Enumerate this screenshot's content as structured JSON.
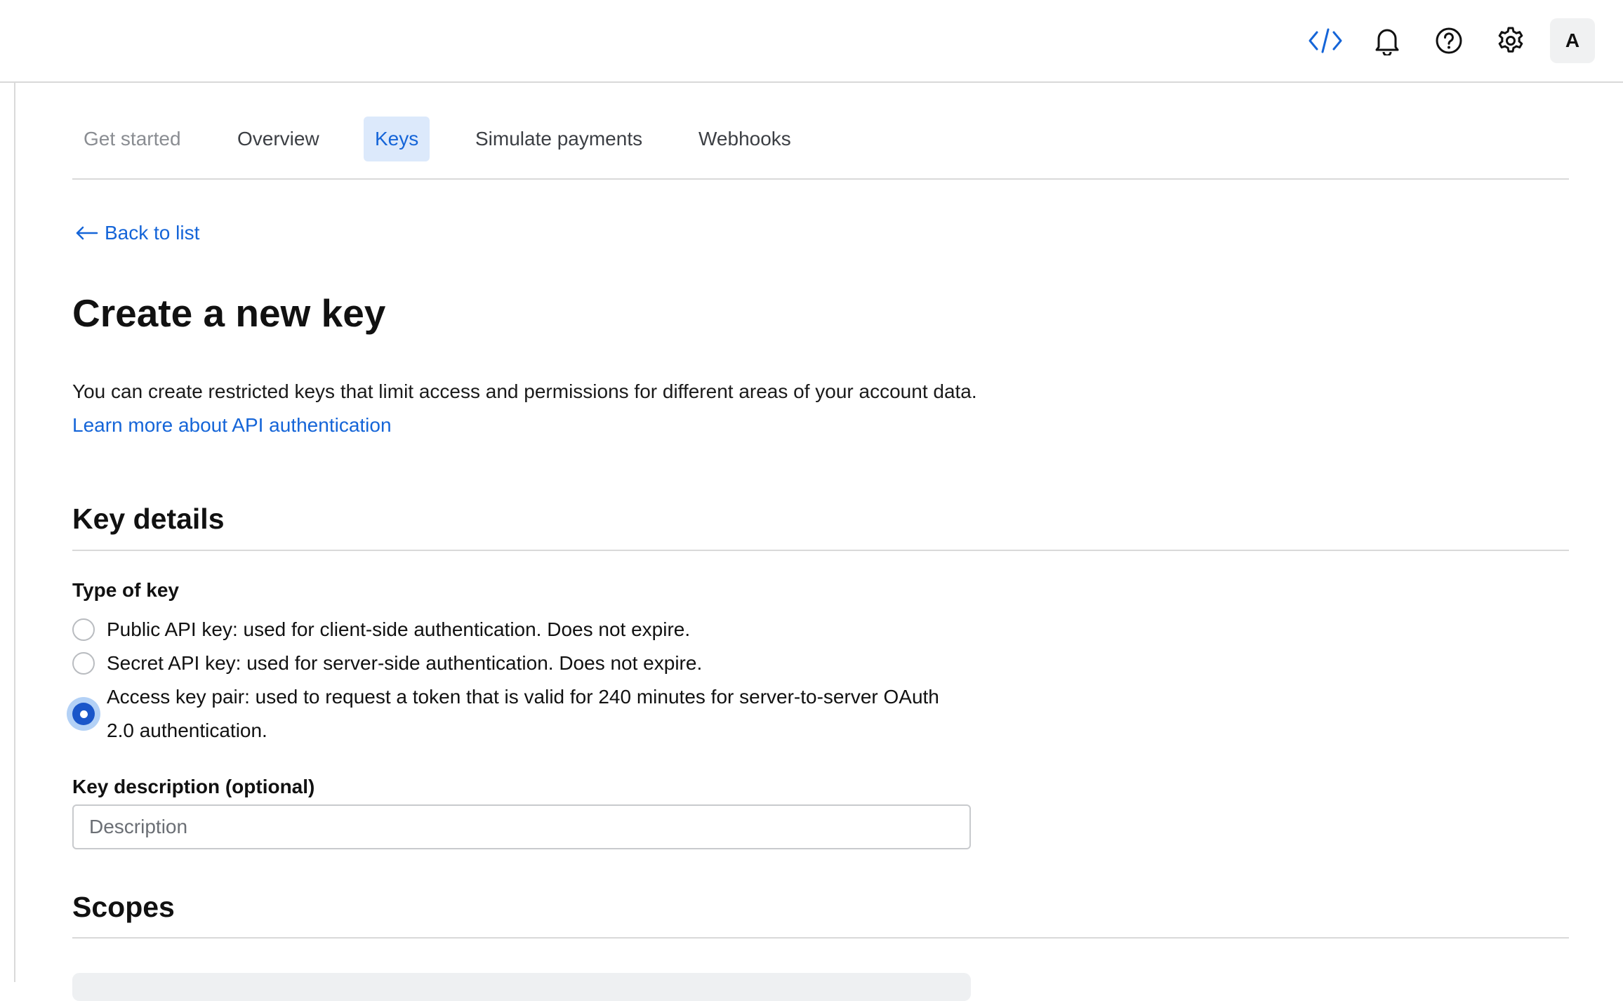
{
  "header": {
    "icons": [
      {
        "name": "code-icon",
        "color": "#1565d8"
      },
      {
        "name": "bell-icon",
        "color": "#111111"
      },
      {
        "name": "help-icon",
        "color": "#111111"
      },
      {
        "name": "gear-icon",
        "color": "#111111"
      }
    ],
    "avatar_initial": "A"
  },
  "tabs": [
    {
      "label": "Get started",
      "state": "disabled"
    },
    {
      "label": "Overview",
      "state": "normal"
    },
    {
      "label": "Keys",
      "state": "active"
    },
    {
      "label": "Simulate payments",
      "state": "normal"
    },
    {
      "label": "Webhooks",
      "state": "normal"
    }
  ],
  "back_link": "Back to list",
  "page_title": "Create a new key",
  "intro": {
    "text": "You can create restricted keys that limit access and permissions for different areas of your account data.",
    "link": "Learn more about API authentication"
  },
  "key_details": {
    "title": "Key details",
    "type_label": "Type of key",
    "options": [
      {
        "label": "Public API key: used for client-side authentication. Does not expire.",
        "selected": false
      },
      {
        "label": "Secret API key: used for server-side authentication. Does not expire.",
        "selected": false
      },
      {
        "label": "Access key pair: used to request a token that is valid for 240 minutes for server-to-server OAuth 2.0 authentication.",
        "selected": true
      }
    ],
    "description_label": "Key description (optional)",
    "description_placeholder": "Description",
    "description_value": ""
  },
  "scopes": {
    "title": "Scopes"
  },
  "colors": {
    "accent": "#1565d8",
    "active_tab_bg": "#dce9fb",
    "radio_selected": "#1a56c9"
  }
}
